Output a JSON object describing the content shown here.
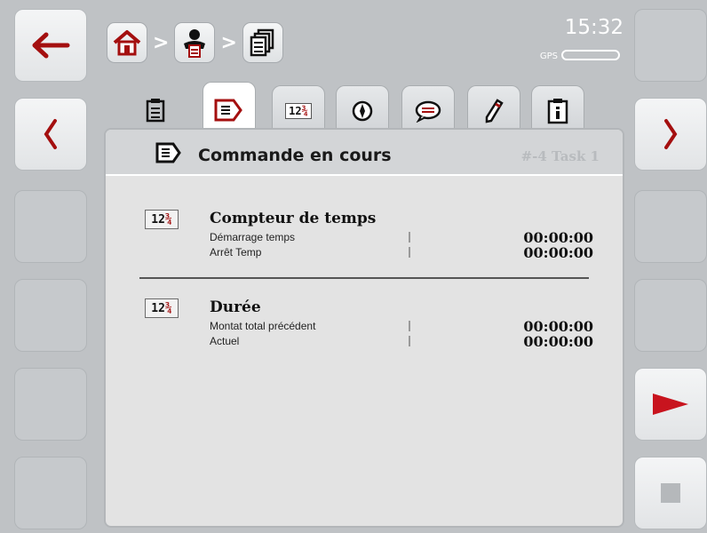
{
  "header": {
    "time": "15:32",
    "gps_label": "GPS",
    "breadcrumb_sep1": ">",
    "breadcrumb_sep2": ">",
    "breadcrumb": [
      "home-icon",
      "driver-icon",
      "task-list-icon"
    ]
  },
  "left_buttons": [
    {
      "icon": "back-arrow-icon",
      "glyph": "←"
    },
    {
      "icon": "chevron-left-icon",
      "glyph": "〈"
    }
  ],
  "right_buttons": [
    {
      "icon": "chevron-right-icon",
      "glyph": "〉"
    },
    {
      "icon": "play-icon",
      "glyph": "▶"
    },
    {
      "icon": "stop-icon"
    }
  ],
  "tabs": [
    "task-data-icon",
    "running-task-icon",
    "counters-icon",
    "compass-icon",
    "notes-icon",
    "edit-icon",
    "info-icon"
  ],
  "panel": {
    "title": "Commande en cours",
    "task": "#-4 Task 1"
  },
  "sections": [
    {
      "icon_text": "12¾",
      "title": "Compteur de temps",
      "rows": [
        {
          "label": "Démarrage temps",
          "value": "00:00:00"
        },
        {
          "label": "Arrêt Temp",
          "value": "00:00:00"
        }
      ]
    },
    {
      "icon_text": "12¾",
      "title": "Durée",
      "rows": [
        {
          "label": "Montat total précédent",
          "value": "00:00:00"
        },
        {
          "label": "Actuel",
          "value": "00:00:00"
        }
      ]
    }
  ],
  "colors": {
    "accent": "#a40f0f",
    "background": "#bfc2c5"
  }
}
